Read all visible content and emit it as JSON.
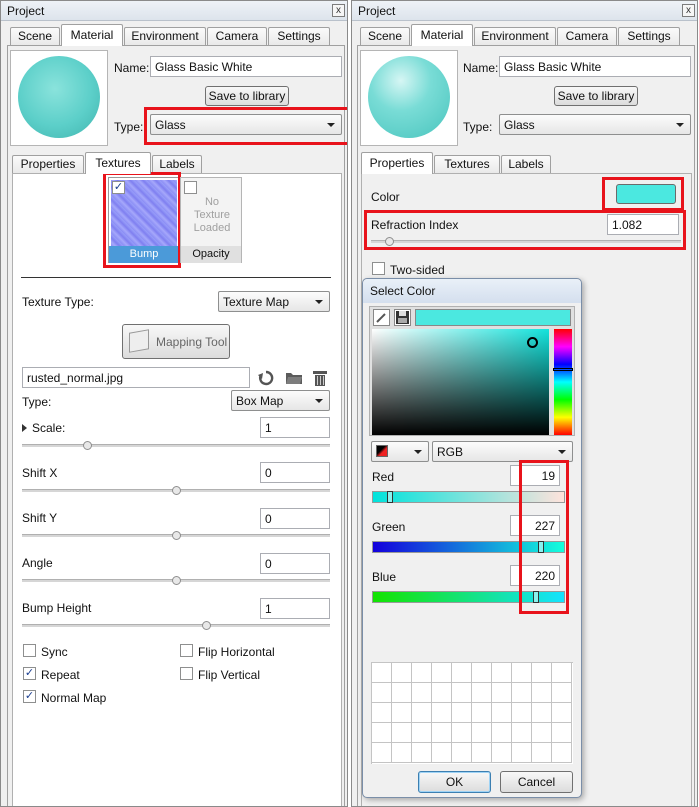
{
  "left": {
    "title": "Project",
    "close": "x",
    "tabs": [
      "Scene",
      "Material",
      "Environment",
      "Camera",
      "Settings"
    ],
    "name_label": "Name:",
    "name_value": "Glass Basic White",
    "save_label": "Save to library",
    "type_label": "Type:",
    "type_value": "Glass",
    "subtabs": [
      "Properties",
      "Textures",
      "Labels"
    ],
    "bump_label": "Bump",
    "no_texture": "No Texture Loaded",
    "opacity_label": "Opacity",
    "texture_type_label": "Texture Type:",
    "texture_type_value": "Texture Map",
    "mapping_tool": "Mapping Tool",
    "file_name": "rusted_normal.jpg",
    "type2_label": "Type:",
    "type2_value": "Box Map",
    "scale_label": "Scale:",
    "scale_value": "1",
    "shiftx_label": "Shift X",
    "shiftx_value": "0",
    "shifty_label": "Shift Y",
    "shifty_value": "0",
    "angle_label": "Angle",
    "angle_value": "0",
    "bump_height_label": "Bump Height",
    "bump_height_value": "1",
    "sync": "Sync",
    "repeat": "Repeat",
    "normal_map": "Normal Map",
    "flip_h": "Flip Horizontal",
    "flip_v": "Flip Vertical",
    "check": "✓"
  },
  "right": {
    "title": "Project",
    "close": "x",
    "tabs": [
      "Scene",
      "Material",
      "Environment",
      "Camera",
      "Settings"
    ],
    "name_label": "Name:",
    "name_value": "Glass Basic White",
    "save_label": "Save to library",
    "type_label": "Type:",
    "type_value": "Glass",
    "subtabs": [
      "Properties",
      "Textures",
      "Labels"
    ],
    "color_label": "Color",
    "color_swatch": "#4be8e0",
    "refraction_label": "Refraction Index",
    "refraction_value": "1.082",
    "two_sided": "Two-sided"
  },
  "dialog": {
    "title": "Select Color",
    "mode": "RGB",
    "red_label": "Red",
    "red_value": "19",
    "green_label": "Green",
    "green_value": "227",
    "blue_label": "Blue",
    "blue_value": "220",
    "ok": "OK",
    "cancel": "Cancel"
  }
}
